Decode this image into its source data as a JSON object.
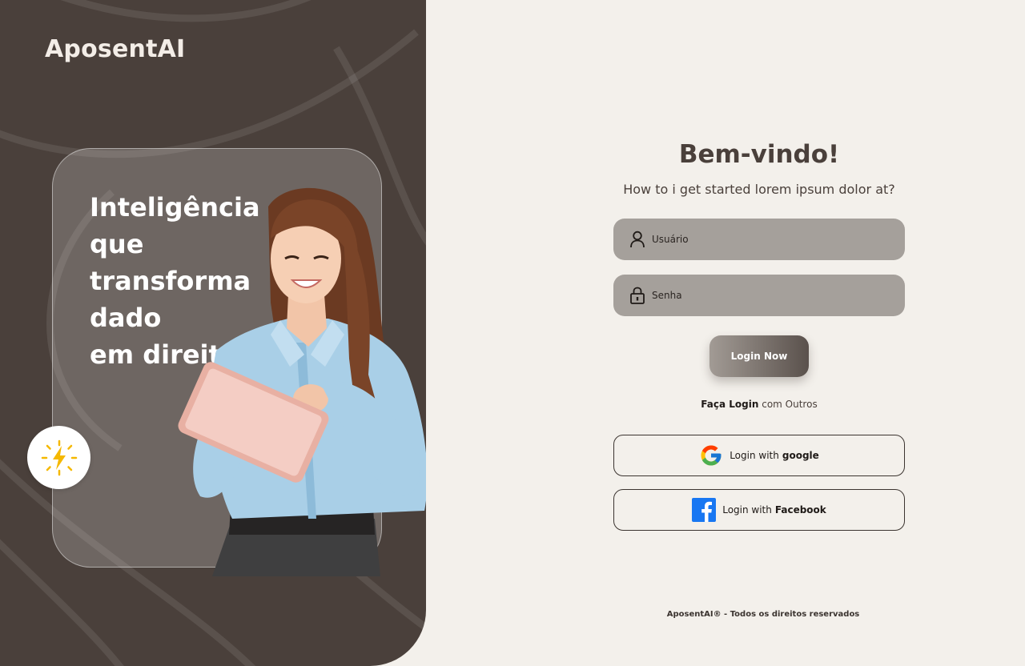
{
  "brand": {
    "name": "AposentAI"
  },
  "hero": {
    "headline_lines": [
      "Inteligência",
      "que",
      "transforma",
      "dado",
      "em direito"
    ]
  },
  "login": {
    "title": "Bem-vindo!",
    "subtitle": "How to i get started lorem ipsum dolor at?",
    "username": {
      "placeholder": "Usuário",
      "value": ""
    },
    "password": {
      "placeholder": "Senha",
      "value": ""
    },
    "submit_label": "Login Now",
    "others_strong": "Faça Login",
    "others_rest": "com Outros",
    "google": {
      "prefix": "Login with",
      "brand": "google"
    },
    "facebook": {
      "prefix": "Login with",
      "brand": "Facebook"
    }
  },
  "footer": {
    "text": "AposentAI® - Todos os direitos reservados"
  },
  "colors": {
    "panel": "#4a403b",
    "background": "#f3f0eb",
    "field": "#a5a09b",
    "text_dark": "#4a403b",
    "facebook_blue": "#1877f2",
    "bolt_yellow": "#f5b800"
  },
  "icons": [
    "user-icon",
    "lock-icon",
    "google-icon",
    "facebook-icon",
    "lightning-bolt-icon"
  ]
}
